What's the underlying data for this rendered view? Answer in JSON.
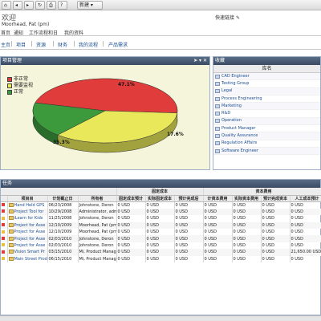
{
  "toolbar": {
    "new_label": "新建 ▾"
  },
  "header": {
    "title": "欢迎",
    "user": "Moorhead, Pat (pm)",
    "quick_links": "快速链接"
  },
  "nav": {
    "items": [
      "首页",
      "通知",
      "工作流程和日",
      "我的资料"
    ]
  },
  "subnav": {
    "items": [
      "主页",
      "项目",
      "资源",
      "财务",
      "我的流程",
      "产品需求"
    ]
  },
  "project_panel": {
    "title": "项目管理",
    "tools": "➤ ▾ ✕"
  },
  "chart_data": {
    "type": "pie",
    "title": "",
    "slices": [
      {
        "label": "非正常",
        "value": 47.1,
        "color": "#e03c3c",
        "data_label": "47.1%"
      },
      {
        "label": "需要监视",
        "value": 35.3,
        "color": "#e8e85a",
        "data_label": "35.3%"
      },
      {
        "label": "正常",
        "value": 17.6,
        "color": "#3c9a3c",
        "data_label": "17.6%"
      }
    ]
  },
  "favorites_panel": {
    "title": "收藏",
    "column_header": "库名",
    "items": [
      "CAD Engineer",
      "Testing Group",
      "Legal",
      "Process Engineering",
      "Marketing",
      "R&D",
      "Operation",
      "Product Manager",
      "Quality Assurance",
      "Regulation Affairs",
      "Software Engineer"
    ]
  },
  "task_panel": {
    "title": "任务"
  },
  "table": {
    "group_headers": {
      "fixed_cost": "固定成本",
      "capital_cost": "资本费用"
    },
    "columns": [
      "",
      "项目目",
      "计划截止日",
      "所有者",
      "固定成本预计",
      "实际固定成本",
      "预计完成后",
      "计资本费用",
      "实际资本费用",
      "预计完成资本",
      "人工成本预计"
    ],
    "rows": [
      {
        "flag": "#e03c3c",
        "name": "Hand Held GPS",
        "date": "06/23/2008",
        "owner": "Johnstone, Deron",
        "c1": "0 USD",
        "c2": "0 USD",
        "c3": "0 USD",
        "c4": "0 USD",
        "c5": "0 USD",
        "c6": "0 USD",
        "c7": "0 USD"
      },
      {
        "flag": "#e03c3c",
        "name": "Project Tool for",
        "date": "10/29/2008",
        "owner": "Administrator, admin",
        "c1": "0 USD",
        "c2": "0 USD",
        "c3": "0 USD",
        "c4": "0 USD",
        "c5": "0 USD",
        "c6": "0 USD",
        "c7": "0 USD"
      },
      {
        "flag": "#e8c040",
        "name": "iLearn for Kids",
        "date": "11/25/2008",
        "owner": "Johnstone, Deron",
        "c1": "0 USD",
        "c2": "0 USD",
        "c3": "0 USD",
        "c4": "0 USD",
        "c5": "0 USD",
        "c6": "0 USD",
        "c7": "0 USD"
      },
      {
        "flag": "#e03c3c",
        "name": "Project for Asse",
        "date": "12/10/2009",
        "owner": "Moorhead, Pat (pm)",
        "c1": "0 USD",
        "c2": "0 USD",
        "c3": "0 USD",
        "c4": "0 USD",
        "c5": "0 USD",
        "c6": "0 USD",
        "c7": "0 USD"
      },
      {
        "flag": "#e8c040",
        "name": "Project for Asse",
        "date": "12/10/2009",
        "owner": "Moorhead, Pat (pm)",
        "c1": "0 USD",
        "c2": "0 USD",
        "c3": "0 USD",
        "c4": "0 USD",
        "c5": "0 USD",
        "c6": "0 USD",
        "c7": "0 USD"
      },
      {
        "flag": "#e03c3c",
        "name": "Project for Asse",
        "date": "02/03/2010",
        "owner": "Johnstone, Deron",
        "c1": "0 USD",
        "c2": "0 USD",
        "c3": "0 USD",
        "c4": "0 USD",
        "c5": "0 USD",
        "c6": "0 USD",
        "c7": "0 USD"
      },
      {
        "flag": "#e8c040",
        "name": "Project for Asse",
        "date": "02/03/2010",
        "owner": "Johnstone, Deron",
        "c1": "0 USD",
        "c2": "0 USD",
        "c3": "0 USD",
        "c4": "0 USD",
        "c5": "0 USD",
        "c6": "0 USD",
        "c7": "0 USD"
      },
      {
        "flag": "#e03c3c",
        "name": "Vision Smart Pr",
        "date": "03/15/2010",
        "owner": "Mi, Product Manage",
        "c1": "0 USD",
        "c2": "0 USD",
        "c3": "0 USD",
        "c4": "0 USD",
        "c5": "0 USD",
        "c6": "0 USD",
        "c7": "21,650.00 USD"
      },
      {
        "flag": "#e8c040",
        "name": "Main Street Prod",
        "date": "06/15/2010",
        "owner": "Mi, Product Manage",
        "c1": "0 USD",
        "c2": "0 USD",
        "c3": "0 USD",
        "c4": "0 USD",
        "c5": "0 USD",
        "c6": "0 USD",
        "c7": "0 USD"
      }
    ]
  }
}
